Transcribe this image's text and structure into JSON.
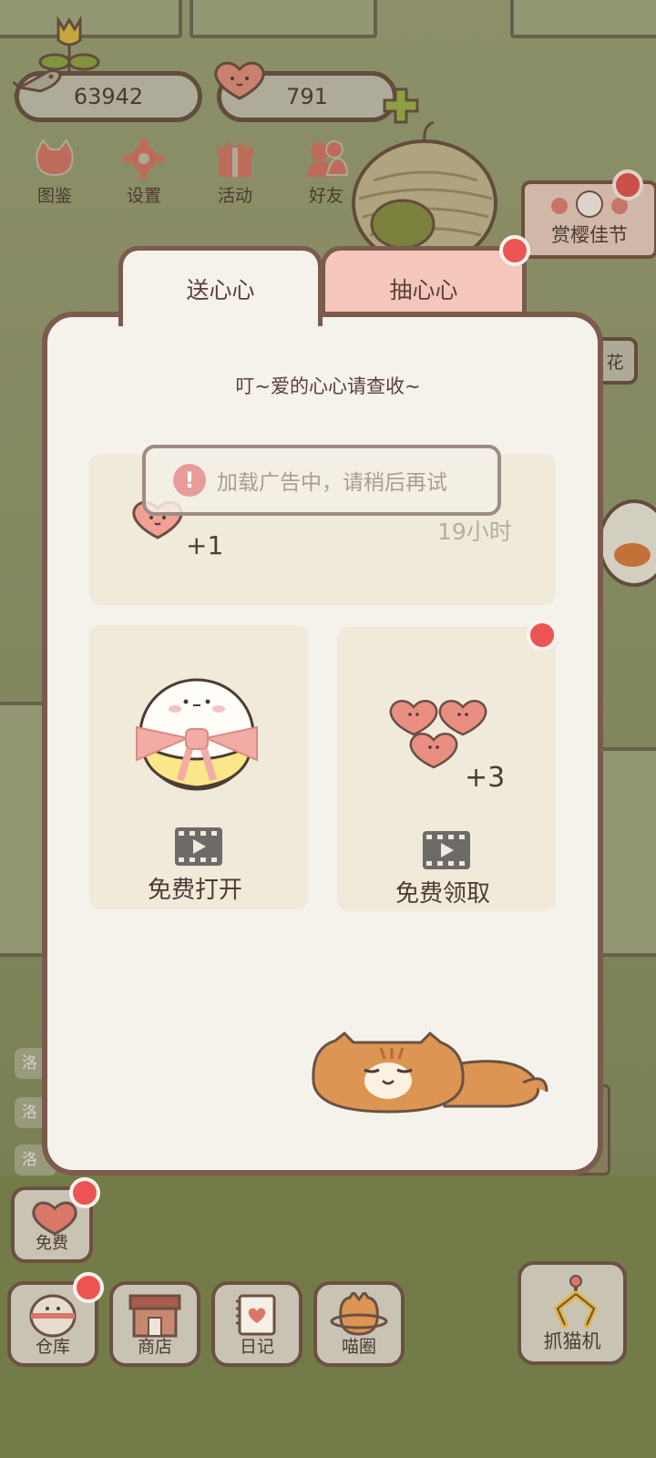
{
  "currency": {
    "coins": "63942",
    "hearts": "791"
  },
  "top_menu": [
    {
      "label": "图鉴",
      "icon": "cat-book-icon"
    },
    {
      "label": "设置",
      "icon": "gear-icon"
    },
    {
      "label": "活动",
      "icon": "gift-icon"
    },
    {
      "label": "好友",
      "icon": "friends-icon"
    }
  ],
  "event": {
    "label": "赏樱佳节"
  },
  "side_partial": {
    "label": "花"
  },
  "side_logs": [
    "洛",
    "洛",
    "洛"
  ],
  "modal": {
    "tabs": {
      "send": "送心心",
      "draw": "抽心心"
    },
    "subtitle": "叮~爱的心心请查收~",
    "top_card": {
      "reward": "+1",
      "timer": "19小时"
    },
    "left_card": {
      "button": "免费打开"
    },
    "right_card": {
      "reward": "+3",
      "button": "免费领取"
    },
    "toast": "加载广告中，请稍后再试"
  },
  "bottom_nav": {
    "free": "免费",
    "warehouse": "仓库",
    "shop": "商店",
    "diary": "日记",
    "circle": "喵圈",
    "claw": "抓猫机"
  },
  "colors": {
    "accent_red": "#ed5454",
    "border_brown": "#7a5b4d",
    "tab_pink": "#f5c7bc",
    "panel_bg": "#f5f2ec"
  }
}
